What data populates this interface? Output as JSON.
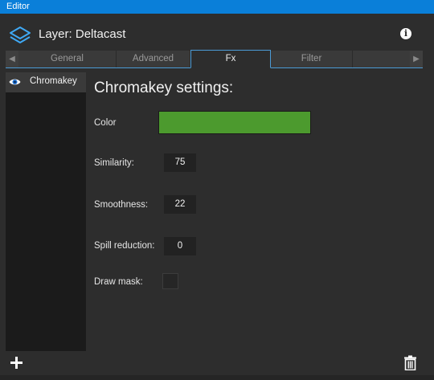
{
  "window": {
    "title": "Editor"
  },
  "header": {
    "layer_title": "Layer: Deltacast",
    "layer_icon": "layers-icon",
    "info_icon": "info-icon",
    "info_glyph": "i"
  },
  "tabs": {
    "items": [
      {
        "label": "General",
        "active": false
      },
      {
        "label": "Advanced",
        "active": false
      },
      {
        "label": "Fx",
        "active": true
      },
      {
        "label": "Filter",
        "active": false
      }
    ],
    "left_arrow_glyph": "◀",
    "right_arrow_glyph": "▶"
  },
  "sidebar": {
    "items": [
      {
        "label": "Chromakey",
        "icon": "eye-icon",
        "visible": true
      }
    ]
  },
  "settings": {
    "title": "Chromakey settings:",
    "color": {
      "label": "Color",
      "value": "#4c9a2e"
    },
    "similarity": {
      "label": "Similarity:",
      "value": "75"
    },
    "smoothness": {
      "label": "Smoothness:",
      "value": "22"
    },
    "spill_reduction": {
      "label": "Spill reduction:",
      "value": "0"
    },
    "draw_mask": {
      "label": "Draw mask:",
      "checked": false
    }
  },
  "footer": {
    "add_icon": "plus-icon",
    "delete_icon": "trash-icon"
  },
  "colors": {
    "titlebar": "#0a7fd9",
    "panel": "#2d2d2d",
    "sidebar": "#1b1b1b",
    "tab_accent": "#4b9bd6",
    "icon_accent": "#3fa9f5"
  }
}
